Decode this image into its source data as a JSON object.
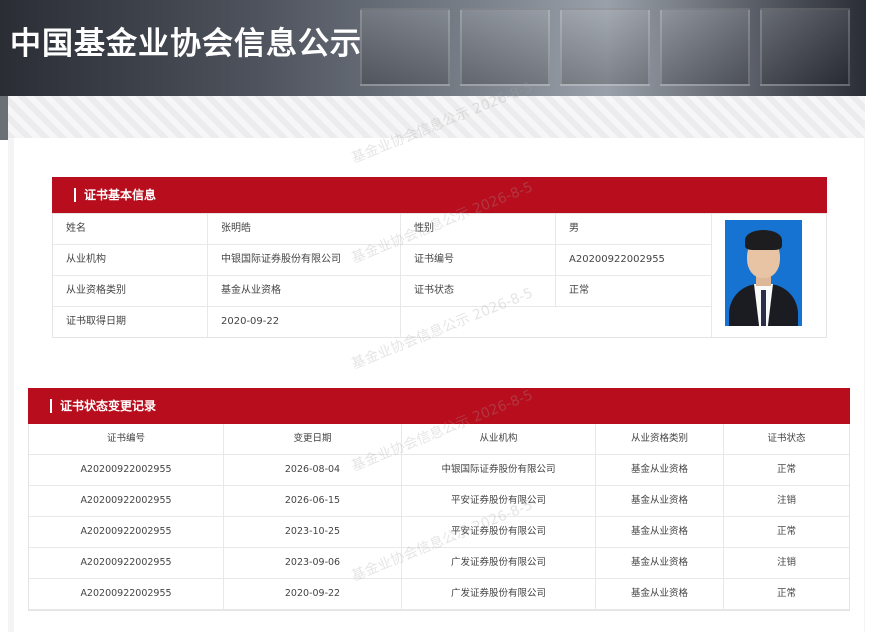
{
  "header": {
    "title": "中国基金业协会信息公示"
  },
  "watermark": "基金业协会信息公示 2026-8-5",
  "basic_info": {
    "section_title": "证书基本信息",
    "rows": [
      {
        "k1": "姓名",
        "v1": "张明皓",
        "k2": "性别",
        "v2": "男"
      },
      {
        "k1": "从业机构",
        "v1": "中银国际证券股份有限公司",
        "k2": "证书编号",
        "v2": "A20200922002955"
      },
      {
        "k1": "从业资格类别",
        "v1": "基金从业资格",
        "k2": "证书状态",
        "v2": "正常"
      },
      {
        "k1": "证书取得日期",
        "v1": "2020-09-22"
      }
    ]
  },
  "change_record": {
    "section_title": "证书状态变更记录",
    "columns": [
      "证书编号",
      "变更日期",
      "从业机构",
      "从业资格类别",
      "证书状态"
    ],
    "rows": [
      [
        "A20200922002955",
        "2026-08-04",
        "中银国际证券股份有限公司",
        "基金从业资格",
        "正常"
      ],
      [
        "A20200922002955",
        "2026-06-15",
        "平安证券股份有限公司",
        "基金从业资格",
        "注销"
      ],
      [
        "A20200922002955",
        "2023-10-25",
        "平安证券股份有限公司",
        "基金从业资格",
        "正常"
      ],
      [
        "A20200922002955",
        "2023-09-06",
        "广发证券股份有限公司",
        "基金从业资格",
        "注销"
      ],
      [
        "A20200922002955",
        "2020-09-22",
        "广发证券股份有限公司",
        "基金从业资格",
        "正常"
      ]
    ]
  },
  "colors": {
    "accent": "#b80d1c"
  }
}
